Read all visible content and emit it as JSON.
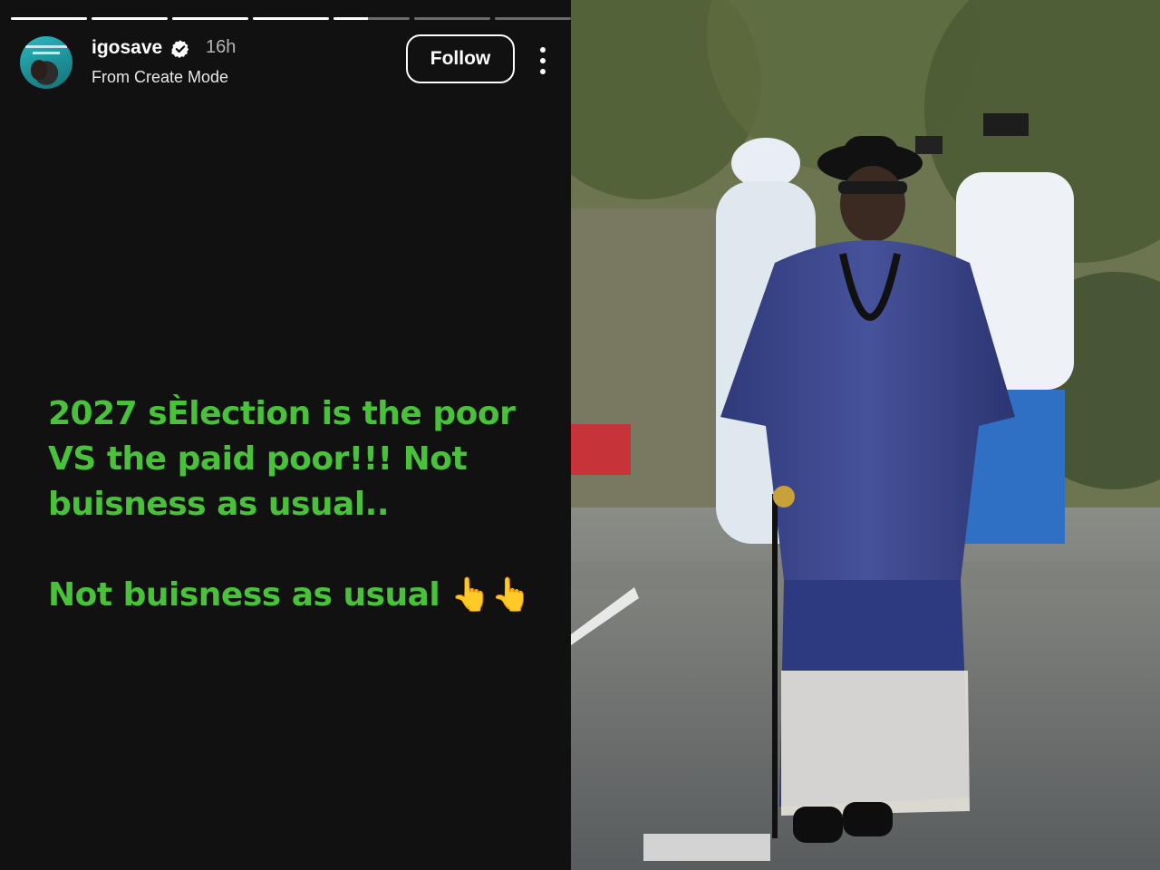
{
  "story": {
    "progress_segments": [
      1,
      1,
      1,
      1,
      0.45,
      0,
      0
    ],
    "username": "igosave",
    "verified": true,
    "time_ago": "16h",
    "subtitle": "From Create Mode",
    "follow_label": "Follow",
    "text_color": "#4ac13a",
    "text_lines": {
      "line1": "2027 sÈlection is the poor",
      "line2": "VS the paid poor!!! Not",
      "line3": "buisness as usual..",
      "line4": "Not buisness as usual 👆👆"
    }
  },
  "icons": {
    "verified": "verified-badge-icon",
    "more": "more-options-icon"
  },
  "photo": {
    "description_tag": "man-in-blue-traditional-attire"
  }
}
